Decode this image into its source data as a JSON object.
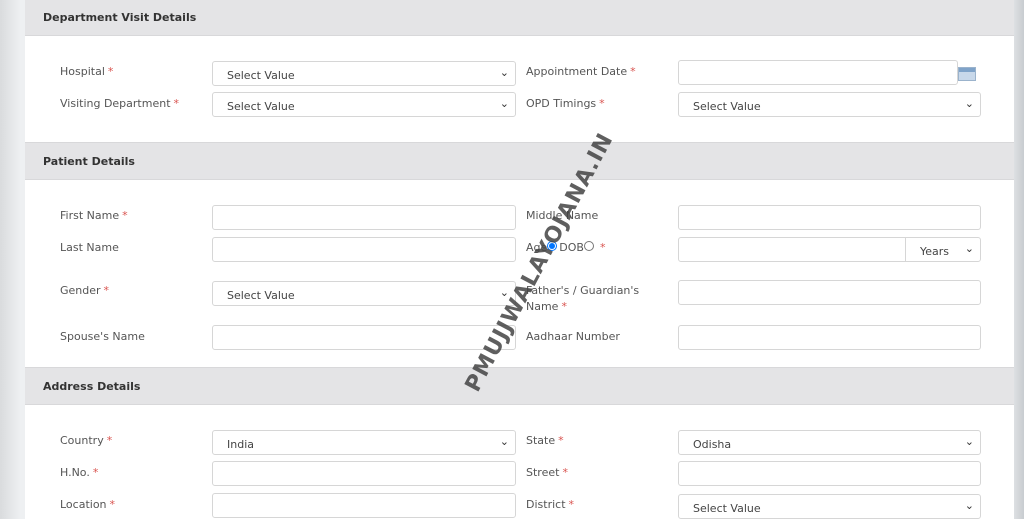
{
  "sections": {
    "department": {
      "title": "Department Visit Details",
      "hospital": {
        "label": "Hospital",
        "value": "Select Value"
      },
      "visiting_department": {
        "label": "Visiting Department",
        "value": "Select Value"
      },
      "appointment_date": {
        "label": "Appointment Date",
        "value": ""
      },
      "opd_timings": {
        "label": "OPD Timings",
        "value": "Select Value"
      }
    },
    "patient": {
      "title": "Patient Details",
      "first_name": {
        "label": "First Name"
      },
      "middle_name": {
        "label": "Middle Name"
      },
      "last_name": {
        "label": "Last Name"
      },
      "age_radio": {
        "label": "Age",
        "checked": true
      },
      "dob_radio": {
        "label": "DOB",
        "checked": false
      },
      "age_unit": {
        "value": "Years"
      },
      "gender": {
        "label": "Gender",
        "value": "Select Value"
      },
      "father_name": {
        "label": "Father's / Guardian's Name"
      },
      "spouse_name": {
        "label": "Spouse's Name"
      },
      "aadhaar": {
        "label": "Aadhaar Number"
      }
    },
    "address": {
      "title": "Address Details",
      "country": {
        "label": "Country",
        "value": "India"
      },
      "state": {
        "label": "State",
        "value": "Odisha"
      },
      "hno": {
        "label": "H.No."
      },
      "street": {
        "label": "Street"
      },
      "location": {
        "label": "Location"
      },
      "district": {
        "label": "District",
        "value": "Select Value"
      }
    }
  },
  "required_mark": "*",
  "watermark": "PMUJJWALAYOJANA.IN",
  "icons": {
    "dropdown": "chevron-down-icon",
    "calendar": "calendar-icon"
  }
}
